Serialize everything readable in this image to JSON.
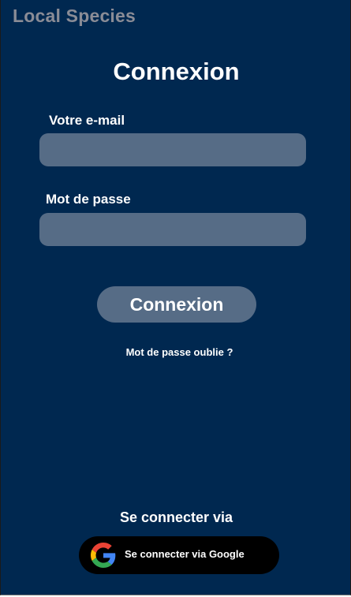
{
  "app": {
    "title": "Local Species"
  },
  "login": {
    "title": "Connexion",
    "email_label": "Votre e-mail",
    "email_value": "",
    "password_label": "Mot de passe",
    "password_value": "",
    "submit_label": "Connexion",
    "forgot_password": "Mot de passe oublie ?"
  },
  "social": {
    "heading": "Se connecter via",
    "google_label": "Se connecter via Google",
    "google_icon": "google-icon"
  },
  "colors": {
    "background": "#002850",
    "input_fill": "#566c86",
    "button_fill": "#566c86",
    "google_button": "#000000",
    "app_title": "#8a8c96",
    "text": "#ffffff"
  }
}
